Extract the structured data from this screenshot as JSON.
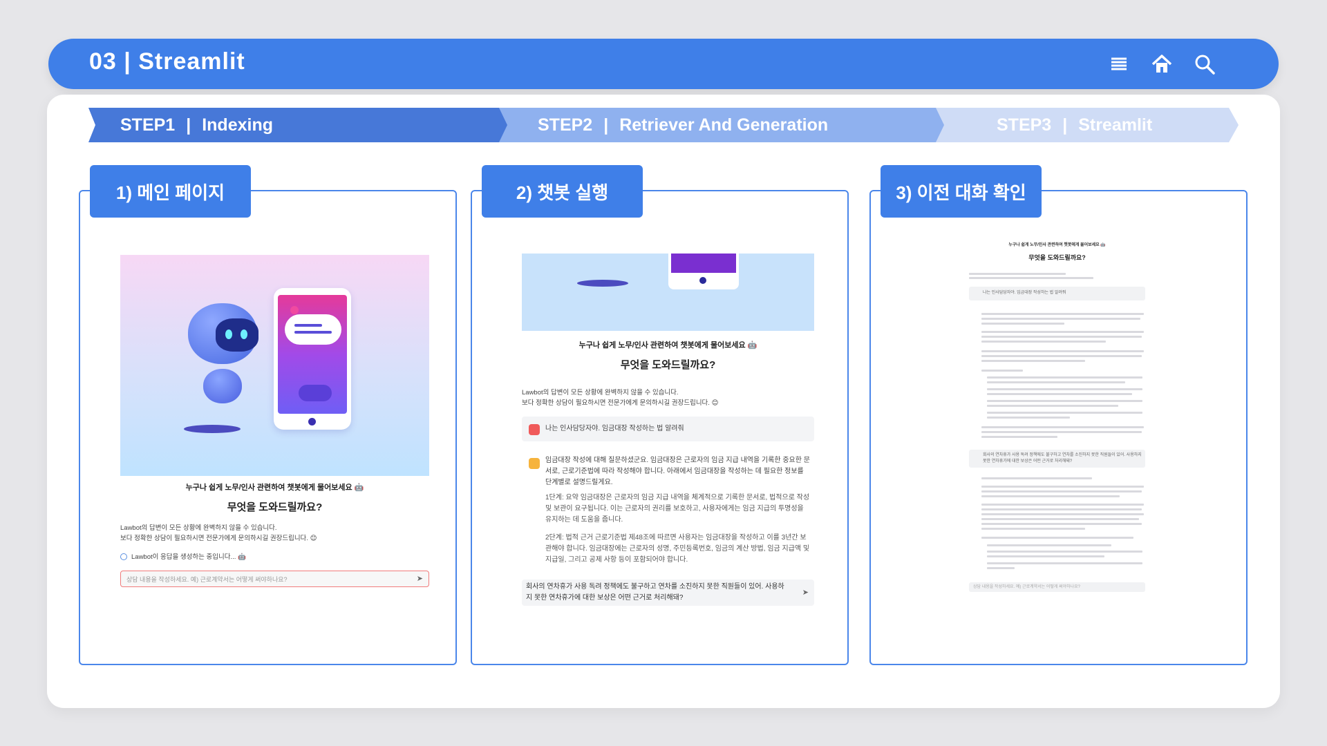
{
  "header": {
    "title": "03 | Streamlit",
    "icons": [
      "menu-icon",
      "home-icon",
      "search-icon"
    ]
  },
  "steps": [
    {
      "num": "STEP1",
      "label": "Indexing"
    },
    {
      "num": "STEP2",
      "label": "Retriever And Generation"
    },
    {
      "num": "STEP3",
      "label": "Streamlit"
    }
  ],
  "panels": [
    {
      "tag": "1) 메인 페이지"
    },
    {
      "tag": "2) 챗봇 실행"
    },
    {
      "tag": "3) 이전 대화 확인"
    }
  ],
  "app": {
    "caption": "누구나 쉽게 노무/인사 관련하여 챗봇에게 물어보세요 🤖",
    "heading": "무엇을 도와드릴까요?",
    "disclaimer_1": "Lawbot의 답변이 모든 상황에 완벽하지 않을 수 있습니다.",
    "disclaimer_2": "보다 정확한 상담이 필요하시면 전문가에게 문의하시길 권장드립니다. 😊",
    "status": "Lawbot이 응답을 생성하는 중입니다... 🤖",
    "input_placeholder": "상담 내용을 작성하세요. 예) 근로계약서는 어떻게 써야하나요?",
    "user_msg": "나는 인사담당자야. 임금대장 작성하는 법 알려줘",
    "bot_msg_1": "임금대장 작성에 대해 질문하셨군요. 임금대장은 근로자의 임금 지급 내역을 기록한 중요한 문서로, 근로기준법에 따라 작성해야 합니다. 아래에서 임금대장을 작성하는 데 필요한 정보를 단계별로 설명드릴게요.",
    "bot_msg_2": "1단계: 요약 임금대장은 근로자의 임금 지급 내역을 체계적으로 기록한 문서로, 법적으로 작성 및 보관이 요구됩니다. 이는 근로자의 권리를 보호하고, 사용자에게는 임금 지급의 투명성을 유지하는 데 도움을 줍니다.",
    "bot_msg_3": "2단계: 법적 근거 근로기준법 제48조에 따르면 사용자는 임금대장을 작성하고 이를 3년간 보관해야 합니다. 임금대장에는 근로자의 성명, 주민등록번호, 임금의 계산 방법, 임금 지급액 및 지급일, 그리고 공제 사항 등이 포함되어야 합니다.",
    "typed_input": "회사의 연차휴가 사용 독려 정책에도 불구하고 연차를 소진하지 못한 직원들이 있어. 사용하지 못한 연차휴가에 대한 보상은 어떤 근거로 처리해돼?"
  },
  "mini_app": {
    "caption": "누구나 쉽게 노무/인사 관련하여 챗봇에게 물어보세요 🤖",
    "heading": "무엇을 도와드릴까요?",
    "user_msg_1": "나는 인사담당자야. 임금대장 작성하는 법 알려줘",
    "user_msg_2": "회사의 연차휴가 사용 독려 정책에도 불구하고 연차를 소진하지 못한 직원들이 있어. 사용하지 못한 연차휴가에 대한 보상은 어떤 근거로 처리해돼?",
    "input_placeholder": "상담 내용을 작성하세요. 예) 근로계약서는 어떻게 써야하나요?"
  },
  "colors": {
    "accent": "#3f7fe8",
    "step1": "#4778d8",
    "step2": "#8fb1ef",
    "step3": "#cfdcf6"
  }
}
